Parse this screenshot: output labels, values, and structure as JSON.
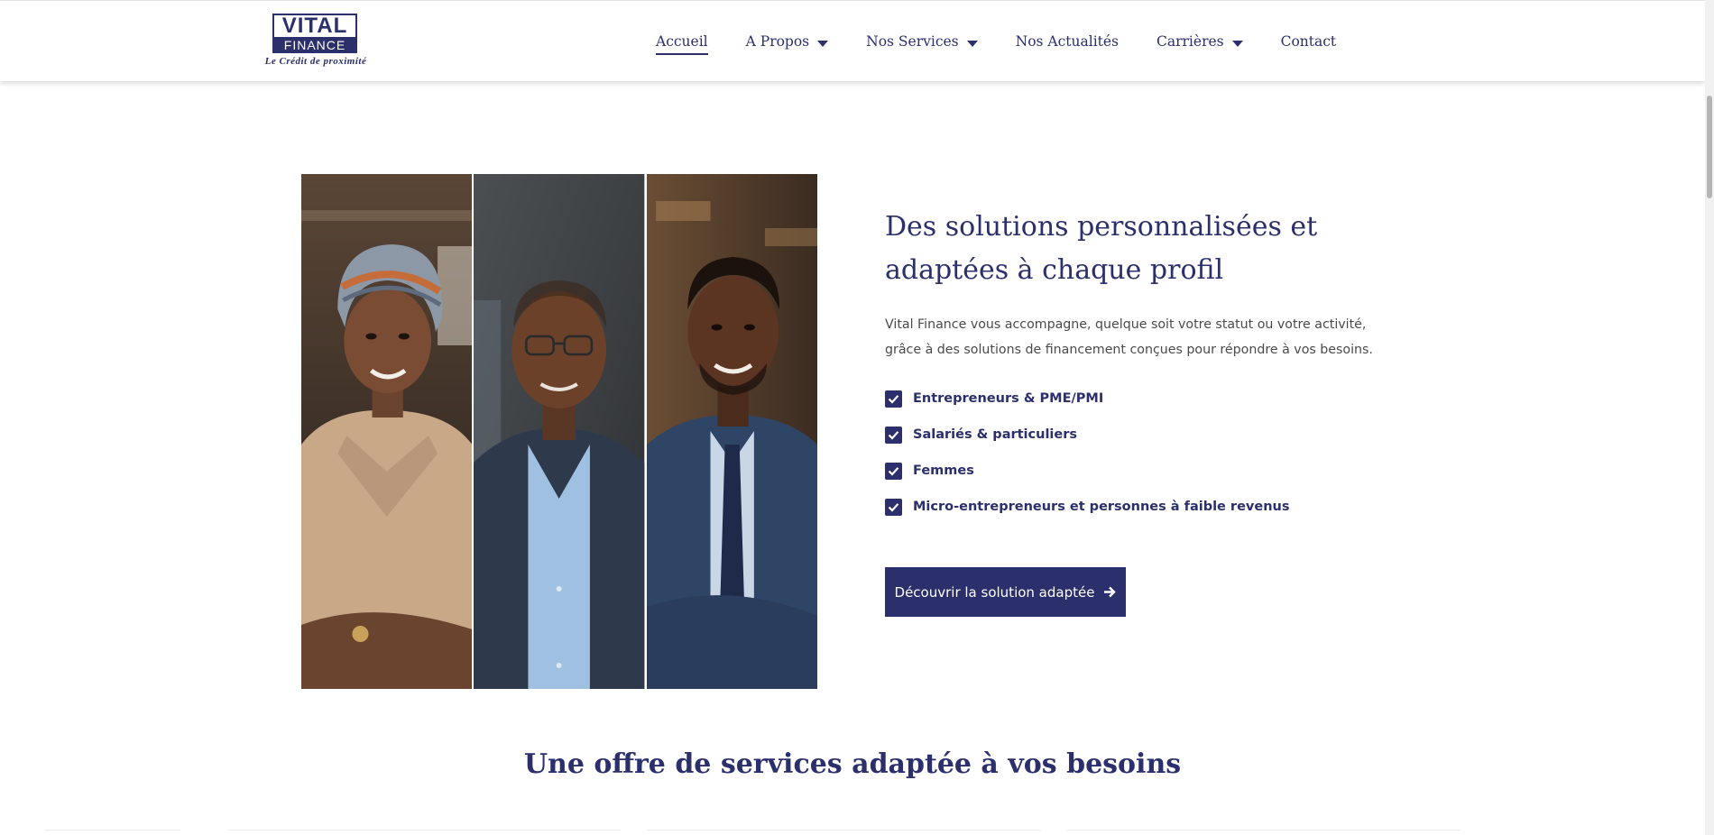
{
  "brand": {
    "logo_top": "VITAL",
    "logo_bottom": "FINANCE",
    "tagline": "Le Crédit de proximité",
    "primary_color": "#2b2f6b"
  },
  "nav": {
    "items": [
      {
        "label": "Accueil",
        "has_dropdown": false,
        "active": true
      },
      {
        "label": "A Propos",
        "has_dropdown": true
      },
      {
        "label": "Nos Services",
        "has_dropdown": true
      },
      {
        "label": "Nos Actualités",
        "has_dropdown": false
      },
      {
        "label": "Carrières",
        "has_dropdown": true
      },
      {
        "label": "Contact",
        "has_dropdown": false
      }
    ]
  },
  "hero": {
    "title": "Des solutions personnalisées et adaptées à chaque profil",
    "description": "Vital Finance vous accompagne, quelque soit votre statut ou votre activité, grâce à des solutions de financement conçues pour répondre à vos besoins.",
    "features": [
      "Entrepreneurs & PME/PMI",
      "Salariés & particuliers",
      "Femmes",
      "Micro-entrepreneurs et personnes à faible revenus"
    ],
    "cta_label": "Découvrir la solution adaptée",
    "cta_icon": "arrow-right-icon"
  },
  "section": {
    "title": "Une offre de services adaptée à vos besoins"
  }
}
